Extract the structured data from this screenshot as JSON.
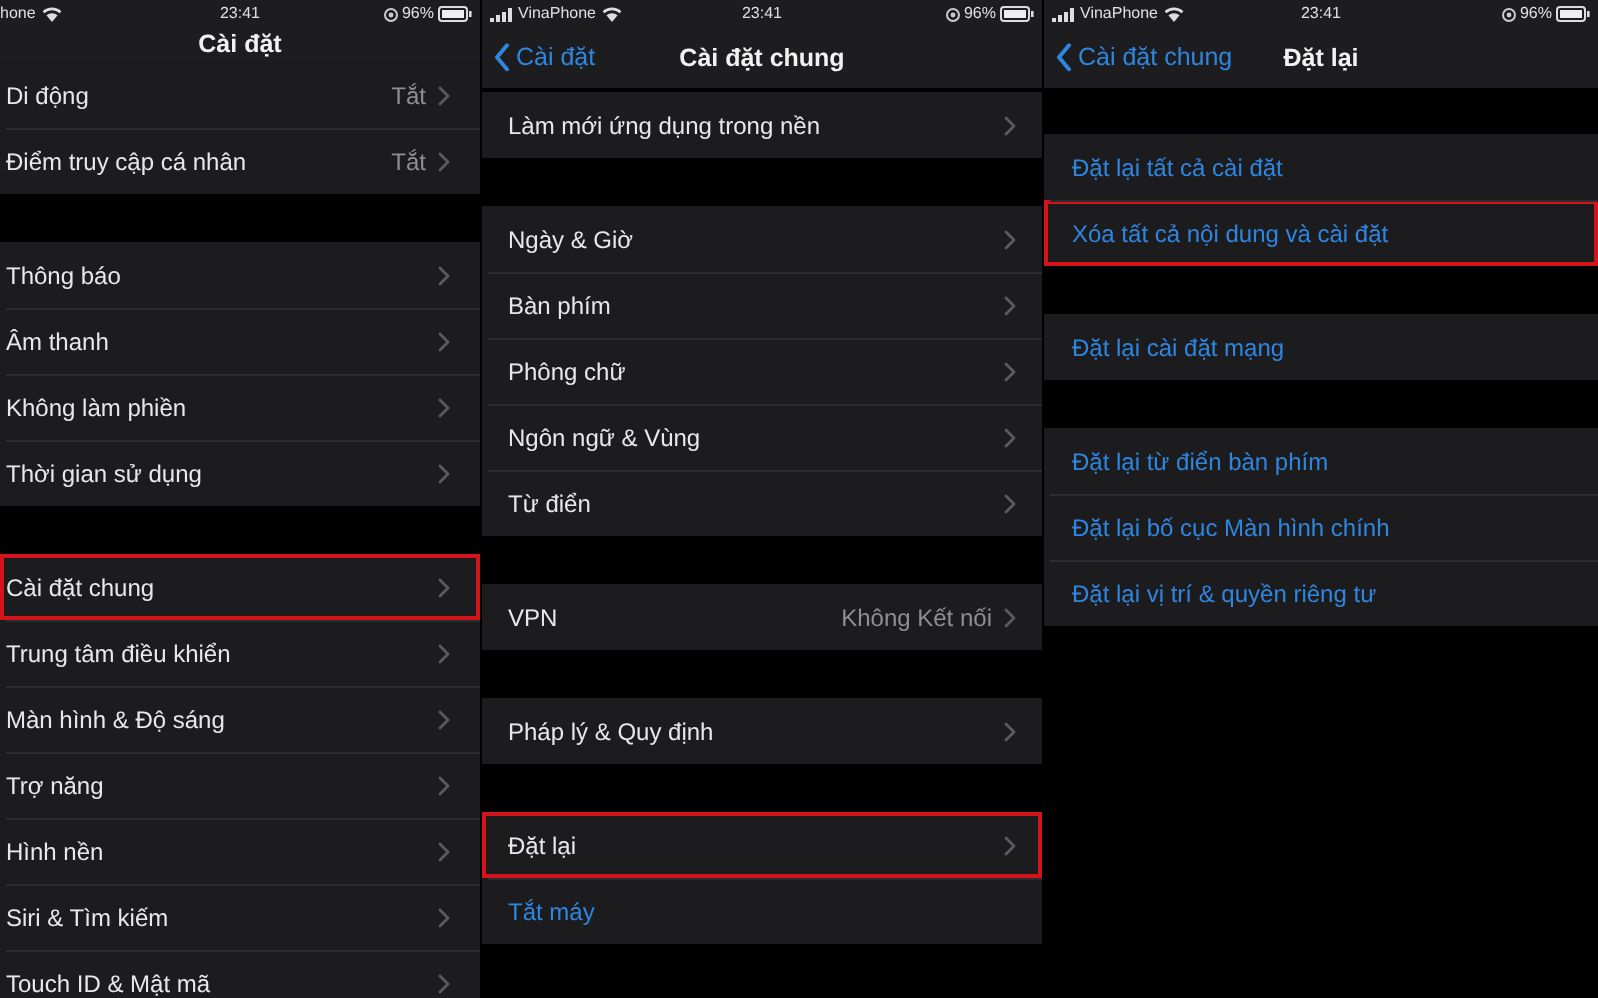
{
  "panels": [
    {
      "status": {
        "carrier": "hone",
        "time": "23:41",
        "battery": "96%"
      },
      "nav": {
        "title": "Cài đặt"
      },
      "groups": [
        [
          {
            "label": "Di động",
            "value": "Tắt",
            "kind": "nav",
            "highlighted": false
          },
          {
            "label": "Điểm truy cập cá nhân",
            "value": "Tắt",
            "kind": "nav",
            "highlighted": false
          }
        ],
        [
          {
            "label": "Thông báo",
            "kind": "nav",
            "highlighted": false
          },
          {
            "label": "Âm thanh",
            "kind": "nav",
            "highlighted": false
          },
          {
            "label": "Không làm phiền",
            "kind": "nav",
            "highlighted": false
          },
          {
            "label": "Thời gian sử dụng",
            "kind": "nav",
            "highlighted": false
          }
        ],
        [
          {
            "label": "Cài đặt chung",
            "kind": "nav",
            "highlighted": true
          },
          {
            "label": "Trung tâm điều khiển",
            "kind": "nav",
            "highlighted": false
          },
          {
            "label": "Màn hình & Độ sáng",
            "kind": "nav",
            "highlighted": false
          },
          {
            "label": "Trợ năng",
            "kind": "nav",
            "highlighted": false
          },
          {
            "label": "Hình nền",
            "kind": "nav",
            "highlighted": false
          },
          {
            "label": "Siri & Tìm kiếm",
            "kind": "nav",
            "highlighted": false
          },
          {
            "label": "Touch ID & Mật mã",
            "kind": "nav",
            "highlighted": false
          }
        ]
      ]
    },
    {
      "status": {
        "carrier": "VinaPhone",
        "time": "23:41",
        "battery": "96%"
      },
      "nav": {
        "back": "Cài đặt",
        "title": "Cài đặt chung"
      },
      "groups": [
        [
          {
            "label": "Làm mới ứng dụng trong nền",
            "kind": "nav",
            "highlighted": false
          }
        ],
        [
          {
            "label": "Ngày & Giờ",
            "kind": "nav",
            "highlighted": false
          },
          {
            "label": "Bàn phím",
            "kind": "nav",
            "highlighted": false
          },
          {
            "label": "Phông chữ",
            "kind": "nav",
            "highlighted": false
          },
          {
            "label": "Ngôn ngữ & Vùng",
            "kind": "nav",
            "highlighted": false
          },
          {
            "label": "Từ điển",
            "kind": "nav",
            "highlighted": false
          }
        ],
        [
          {
            "label": "VPN",
            "value": "Không Kết nối",
            "kind": "nav",
            "highlighted": false
          }
        ],
        [
          {
            "label": "Pháp lý & Quy định",
            "kind": "nav",
            "highlighted": false
          }
        ],
        [
          {
            "label": "Đặt lại",
            "kind": "nav",
            "highlighted": true
          },
          {
            "label": "Tắt máy",
            "kind": "action",
            "highlighted": false
          }
        ]
      ]
    },
    {
      "status": {
        "carrier": "VinaPhone",
        "time": "23:41",
        "battery": "96%"
      },
      "nav": {
        "back": "Cài đặt chung",
        "title": "Đặt lại"
      },
      "groups": [
        [
          {
            "label": "Đặt lại tất cả cài đặt",
            "kind": "action",
            "highlighted": false
          },
          {
            "label": "Xóa tất cả nội dung và cài đặt",
            "kind": "action",
            "highlighted": true
          }
        ],
        [
          {
            "label": "Đặt lại cài đặt mạng",
            "kind": "action",
            "highlighted": false
          }
        ],
        [
          {
            "label": "Đặt lại từ điển bàn phím",
            "kind": "action",
            "highlighted": false
          },
          {
            "label": "Đặt lại bố cục Màn hình chính",
            "kind": "action",
            "highlighted": false
          },
          {
            "label": "Đặt lại vị trí & quyền riêng tư",
            "kind": "action",
            "highlighted": false
          }
        ]
      ]
    }
  ]
}
